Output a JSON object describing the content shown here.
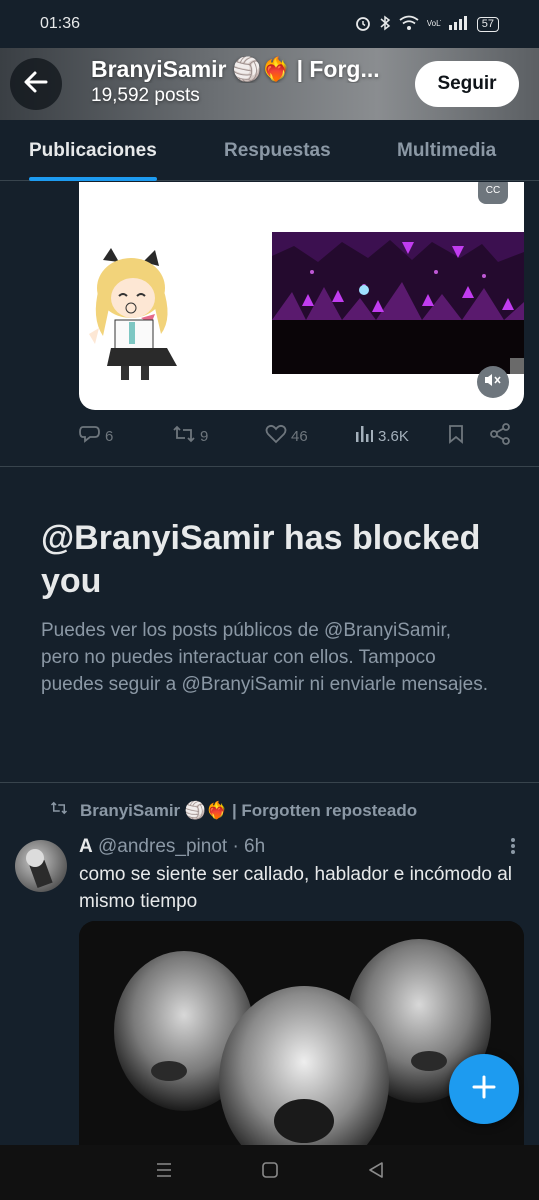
{
  "status_bar": {
    "time": "01:36",
    "battery": "57",
    "network_label": "VoLTE"
  },
  "header": {
    "name": "BranyiSamir 🏐❤️‍🔥 | Forg...",
    "posts_count": "19,592 posts",
    "follow_label": "Seguir"
  },
  "tabs": [
    {
      "label": "Publicaciones",
      "active": true
    },
    {
      "label": "Respuestas",
      "active": false
    },
    {
      "label": "Multimedia",
      "active": false
    }
  ],
  "media": {
    "cc_label": "CC"
  },
  "actions": {
    "replies": "6",
    "reposts": "9",
    "likes": "46",
    "views": "3.6K"
  },
  "blocked": {
    "title": "@BranyiSamir has blocked you",
    "description": "Puedes ver los posts públicos de @BranyiSamir, pero no puedes interactuar con ellos. Tampoco puedes seguir a @BranyiSamir ni enviarle mensajes."
  },
  "repost": {
    "label": "BranyiSamir 🏐❤️‍🔥 | Forgotten reposteado",
    "author_name": "A",
    "author_handle": "@andres_pinot",
    "time": "· 6h",
    "text": "como se siente ser callado, hablador e incómodo al mismo tiempo"
  },
  "colors": {
    "background": "#15202b",
    "accent": "#1d9bf0",
    "secondary_text": "#8b98a5",
    "border": "#38444d"
  }
}
